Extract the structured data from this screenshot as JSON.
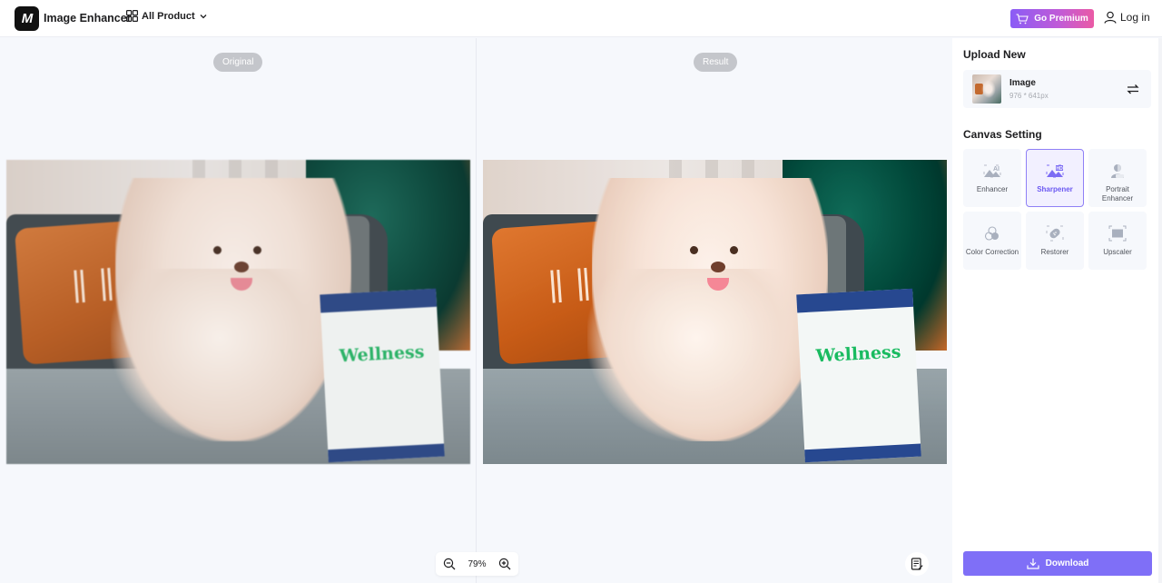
{
  "header": {
    "logo_text": "M",
    "app_title": "Image Enhancer",
    "all_product_label": "All Product",
    "premium_label": "Go Premium",
    "login_label": "Log in"
  },
  "canvas": {
    "original_label": "Original",
    "result_label": "Result",
    "photo_bag_text": "Wellness",
    "zoom_value": "79%"
  },
  "sidebar": {
    "upload_title": "Upload New",
    "upload": {
      "name": "Image",
      "size": "976 * 641px"
    },
    "canvas_title": "Canvas Setting",
    "tools": [
      {
        "label": "Enhancer",
        "icon": "ai-image-icon",
        "active": false
      },
      {
        "label": "Sharpener",
        "icon": "hd-image-icon",
        "active": true
      },
      {
        "label": "Portrait Enhancer",
        "icon": "portrait-icon",
        "active": false
      },
      {
        "label": "Color Correction",
        "icon": "color-circles-icon",
        "active": false
      },
      {
        "label": "Restorer",
        "icon": "bandage-icon",
        "active": false
      },
      {
        "label": "Upscaler",
        "icon": "upscale-icon",
        "active": false
      }
    ],
    "download_label": "Download"
  },
  "colors": {
    "accent": "#7f6ff7",
    "active_border": "#8f80f6",
    "premium_gradient_start": "#8a5cf6",
    "premium_gradient_end": "#ea5aa5"
  }
}
